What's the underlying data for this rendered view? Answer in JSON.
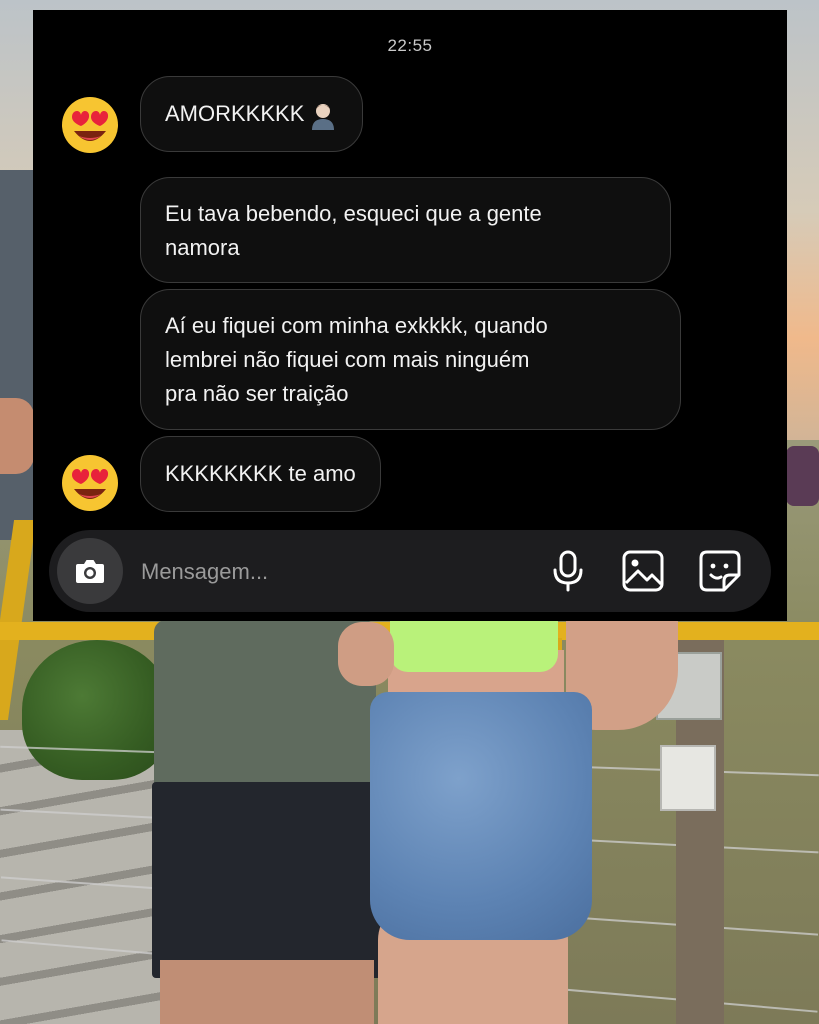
{
  "status": {
    "time": "22:55"
  },
  "messages": [
    {
      "text": "AMORKKKKK",
      "reaction": "heart-eyes-emoji",
      "extra_emoji": "man-emoji"
    },
    {
      "text": "Eu tava bebendo, esqueci que a gente\nnamora"
    },
    {
      "text": "Aí eu fiquei com minha exkkkk, quando\nlembrei não fiquei com mais ninguém\npra não ser traição"
    },
    {
      "text": "KKKKKKKK te amo",
      "reaction": "heart-eyes-emoji"
    }
  ],
  "composer": {
    "placeholder": "Mensagem...",
    "icons": [
      "camera-icon",
      "microphone-icon",
      "gallery-icon",
      "sticker-icon"
    ]
  },
  "colors": {
    "chat_background": "#000000",
    "bubble_border": "#3a3a3a",
    "composer_background": "#1d1d1f",
    "camera_button": "#3a3a3c"
  }
}
